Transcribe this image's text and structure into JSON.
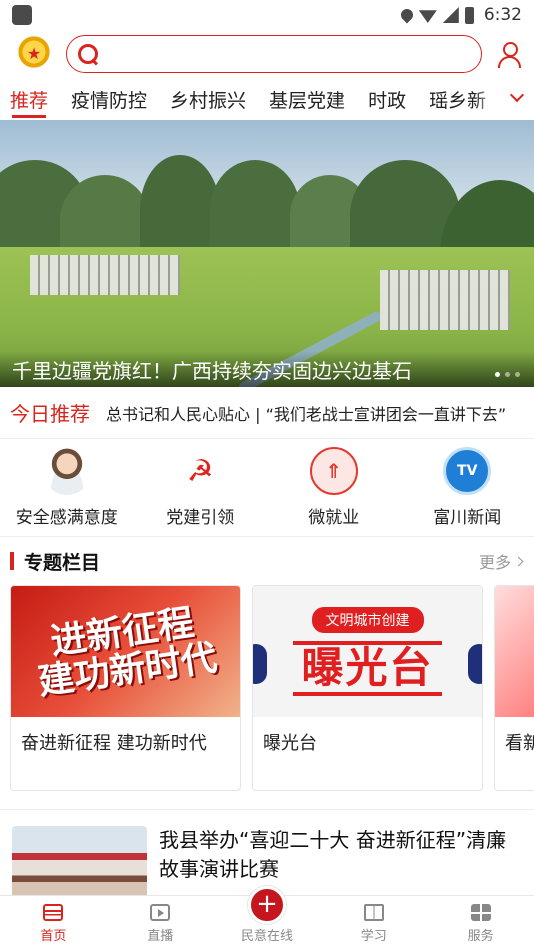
{
  "status_bar": {
    "time": "6:32"
  },
  "search": {
    "placeholder": ""
  },
  "tabs": [
    {
      "label": "推荐",
      "active": true
    },
    {
      "label": "疫情防控"
    },
    {
      "label": "乡村振兴"
    },
    {
      "label": "基层党建"
    },
    {
      "label": "时政"
    },
    {
      "label": "瑶乡新"
    }
  ],
  "banner": {
    "caption": "千里边疆党旗红！广西持续夯实固边兴边基石",
    "slide_count": 3,
    "active_slide": 1
  },
  "today": {
    "label": "今日推荐",
    "text": "总书记和人民心贴心 | “我们老战士宣讲团会一直讲下去”"
  },
  "shortcuts": [
    {
      "label": "安全感满意度",
      "icon": "person-avatar-icon"
    },
    {
      "label": "党建引领",
      "icon": "hammer-sickle-icon"
    },
    {
      "label": "微就业",
      "icon": "job-icon"
    },
    {
      "label": "富川新闻",
      "icon": "tv-icon"
    }
  ],
  "special": {
    "title": "专题栏目",
    "more": "更多",
    "cards": [
      {
        "title": "奋进新征程 建功新时代",
        "img_text_1": "进新征程",
        "img_text_2": "建功新时代"
      },
      {
        "title": "曝光台",
        "img_pill": "文明城市创建",
        "img_text": "曝光台"
      },
      {
        "title": "看新"
      }
    ]
  },
  "news": [
    {
      "title": "我县举办“喜迎二十大 奋进新征程”清廉故事演讲比赛"
    }
  ],
  "bottom_nav": [
    {
      "label": "首页",
      "active": true
    },
    {
      "label": "直播"
    },
    {
      "label": "民意在线"
    },
    {
      "label": "学习"
    },
    {
      "label": "服务"
    }
  ],
  "colors": {
    "accent": "#d9251d"
  }
}
